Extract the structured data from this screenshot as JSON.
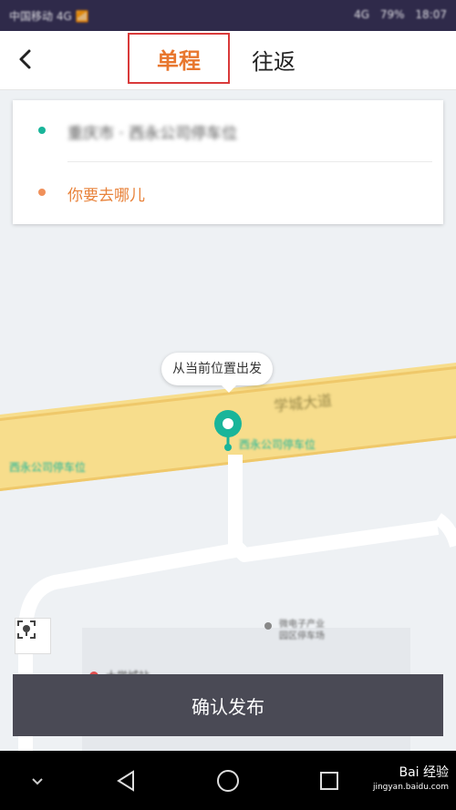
{
  "status_bar": {
    "carrier": "中国移动 4G 📶",
    "network": "4G",
    "battery": "79%",
    "time": "18:07"
  },
  "header": {
    "back_icon": "chevron-left-icon",
    "tab_single": "单程",
    "tab_round": "往返",
    "active_tab_color": "#e8772e",
    "highlight_color": "#d93a3a"
  },
  "route_card": {
    "origin": "重庆市 · 西永公司停车位",
    "destination_placeholder": "你要去哪儿"
  },
  "map": {
    "tooltip": "从当前位置出发",
    "road_name": "学城大道",
    "bus_stop_near_pin": "西永公司停车位",
    "bus_stop_left": "西永公司停车位",
    "poi_name_line1": "微电子产业",
    "poi_name_line2": "园区停车场",
    "red_poi": "大学城站"
  },
  "actions": {
    "confirm_label": "确认发布",
    "confirm_bg": "#4a4a55"
  },
  "nav_bar": {
    "back_icon": "triangle-back-icon",
    "home_icon": "circle-home-icon",
    "recent_icon": "square-recent-icon",
    "menu_icon": "chevron-down-icon"
  },
  "watermark": {
    "brand": "Bai 经验",
    "url": "jingyan.baidu.com"
  }
}
